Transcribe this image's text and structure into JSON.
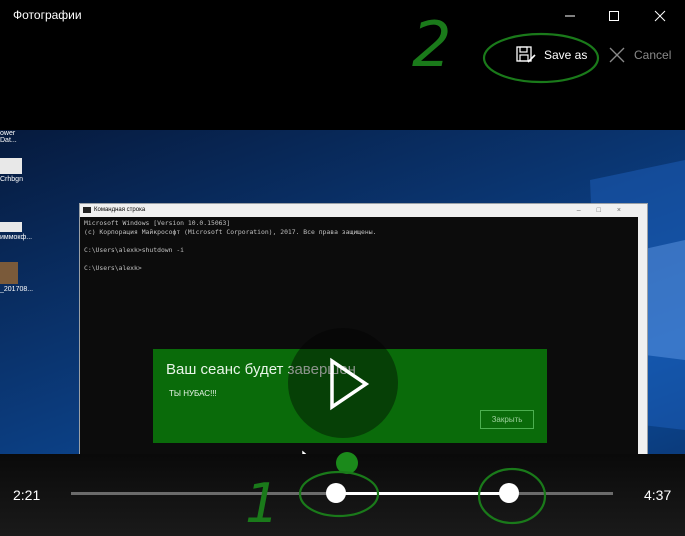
{
  "window": {
    "title": "Фотографии",
    "minimize_icon": "minimize-icon",
    "maximize_icon": "maximize-icon",
    "close_icon": "close-icon"
  },
  "toolbar": {
    "save_as_label": "Save as",
    "cancel_label": "Cancel"
  },
  "video_frame": {
    "desktop_icons": [
      "ower Dat...",
      "Crhbgn",
      "иммокф...",
      "_201708..."
    ],
    "cmd": {
      "title": "Командная строка",
      "lines": [
        "Microsoft Windows [Version 10.0.15063]",
        "(c) Корпорация Майкрософт (Microsoft Corporation), 2017. Все права защищены.",
        "",
        "C:\\Users\\alexk>shutdown -i",
        "",
        "C:\\Users\\alexk>"
      ]
    },
    "dialog": {
      "heading": "Ваш сеанс будет завершен",
      "message": "ТЫ НУБАС!!!",
      "button": "Закрыть"
    }
  },
  "timeline": {
    "start_time": "2:21",
    "end_time": "4:37",
    "trim_start_fraction": 0.489,
    "trim_end_fraction": 0.808
  },
  "annotations": {
    "marker_1": "1",
    "marker_2": "2",
    "color": "#1a7a1a"
  }
}
